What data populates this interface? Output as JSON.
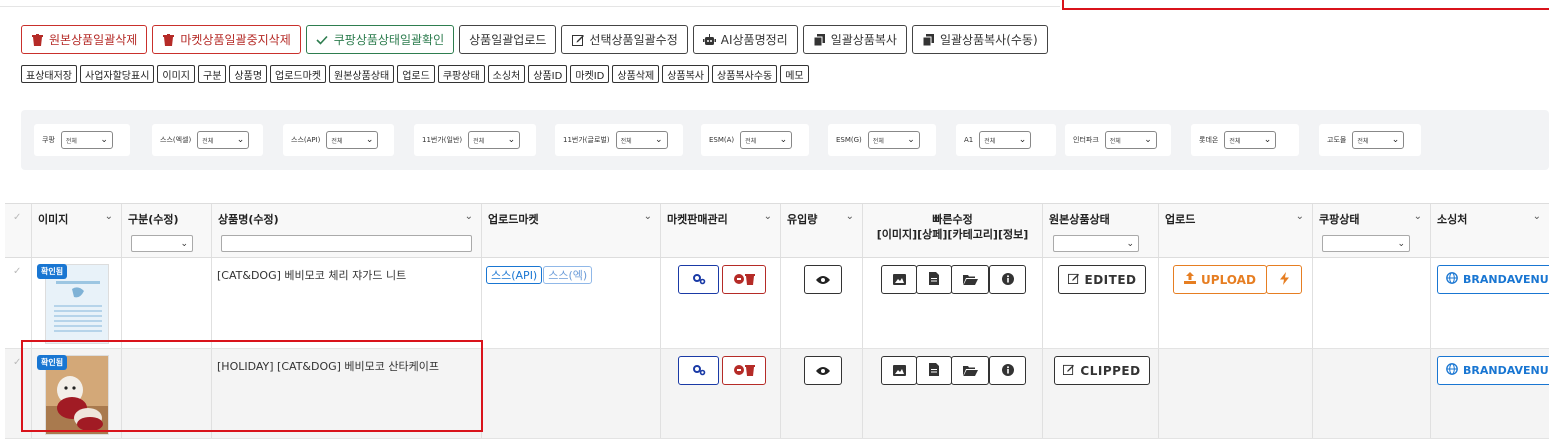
{
  "actions": {
    "delete_original_bulk": "원본상품일괄삭제",
    "delete_market_bulk": "마켓상품일괄중지삭제",
    "coupang_status_check": "쿠팡상품상태일괄확인",
    "bulk_upload": "상품일괄업로드",
    "edit_selected_bulk": "선택상품일괄수정",
    "ai_name_cleanup": "AI상품명정리",
    "bulk_copy": "일괄상품복사",
    "bulk_copy_manual": "일괄상품복사(수동)"
  },
  "column_toggles": [
    "표상태저장",
    "사업자할당표시",
    "이미지",
    "구분",
    "상품명",
    "업로드마켓",
    "원본상품상태",
    "업로드",
    "쿠팡상태",
    "소싱처",
    "상품ID",
    "마켓ID",
    "상품삭제",
    "상품복사",
    "상품복사수동",
    "메모"
  ],
  "filters": [
    {
      "label": "쿠팡",
      "value": "전체"
    },
    {
      "label": "스스(엑셀)",
      "value": "전체"
    },
    {
      "label": "스스(API)",
      "value": "전체"
    },
    {
      "label": "11번가(일반)",
      "value": "전체"
    },
    {
      "label": "11번가(글로벌)",
      "value": "전체"
    },
    {
      "label": "ESM(A)",
      "value": "전체"
    },
    {
      "label": "ESM(G)",
      "value": "전체"
    },
    {
      "label": "A1",
      "value": "전체"
    },
    {
      "label": "인터파크",
      "value": "전체"
    },
    {
      "label": "롯데온",
      "value": "전체"
    },
    {
      "label": "고도몰",
      "value": "전체"
    }
  ],
  "table": {
    "headers": {
      "image": "이미지",
      "category": "구분(수정)",
      "name": "상품명(수정)",
      "upload_market": "업로드마켓",
      "market_manage": "마켓판매관리",
      "traffic": "유입량",
      "quick_edit": "빠른수정",
      "quick_edit_sub": "[이미지][상페][카테고리][정보]",
      "origin_status": "원본상품상태",
      "upload": "업로드",
      "coupang_status": "쿠팡상태",
      "source": "소싱처"
    },
    "rows": [
      {
        "badge": "확인됨",
        "name": "[CAT&DOG] 베비모코 체리 쟈가드 니트",
        "markets": [
          "스스(API)",
          "스스(엑)"
        ],
        "origin_status": "EDITED",
        "upload_label": "UPLOAD",
        "source": "BRANDAVENUE"
      },
      {
        "badge": "확인됨",
        "name": "[HOLIDAY] [CAT&DOG] 베비모코 산타케이프",
        "markets": [],
        "origin_status": "CLIPPED",
        "upload_label": "",
        "source": "BRANDAVENUE"
      }
    ]
  },
  "colors": {
    "danger": "#b52b27",
    "success": "#2e7d4f",
    "primary": "#1976d2",
    "warning": "#e67e22",
    "highlight": "#d9131b"
  }
}
